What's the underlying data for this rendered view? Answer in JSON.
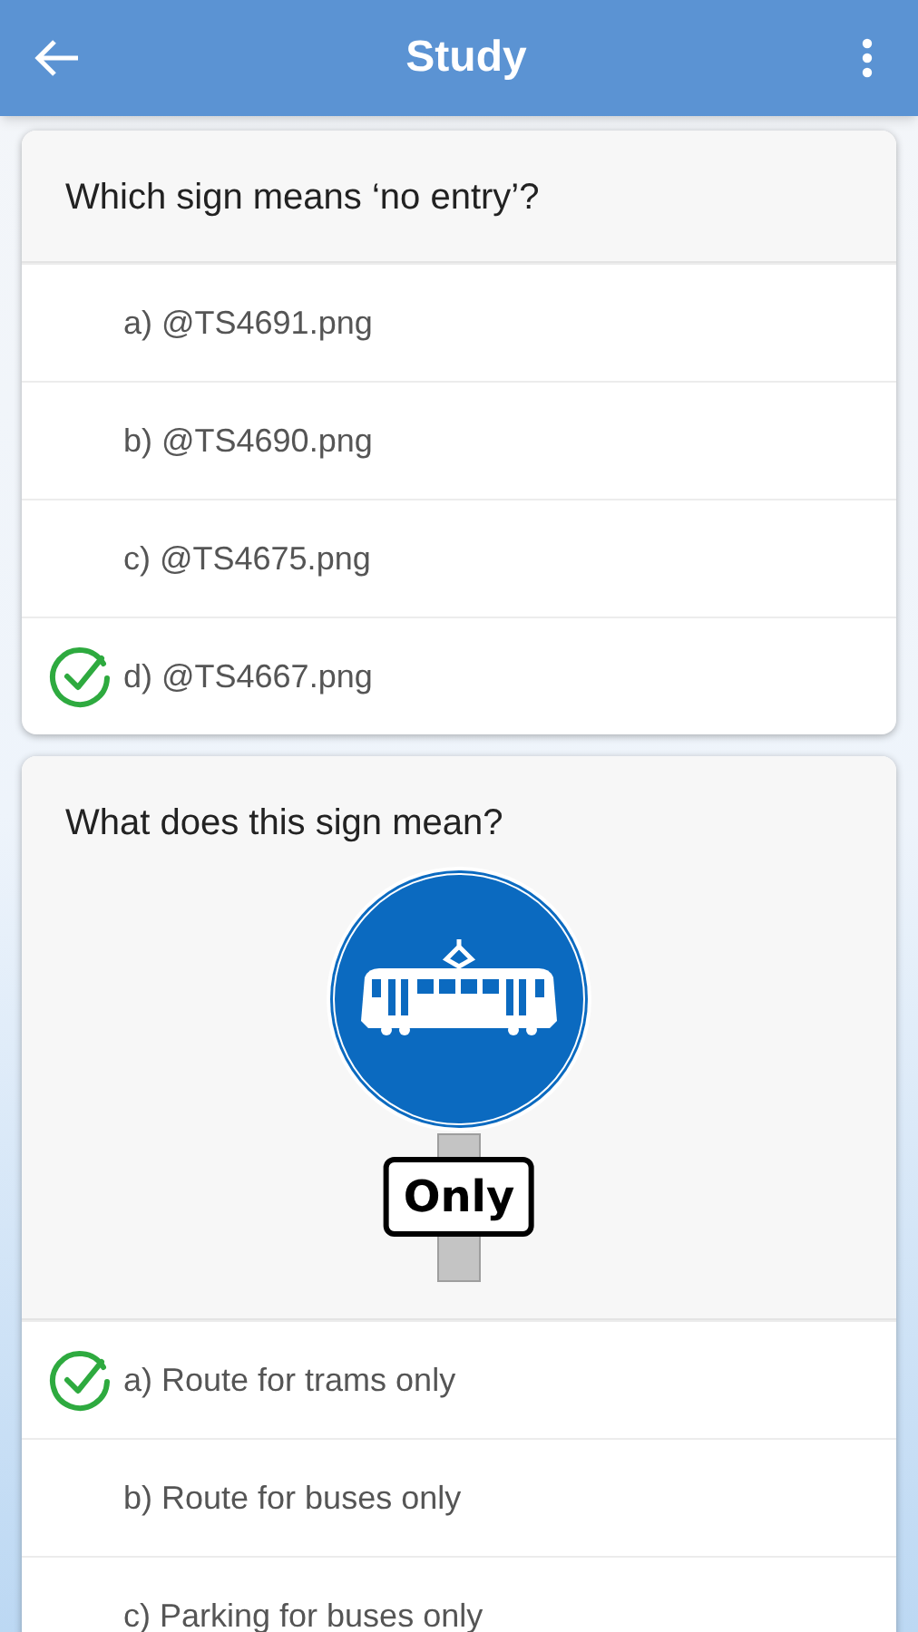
{
  "app_bar": {
    "title": "Study"
  },
  "questions": [
    {
      "text": "Which sign means ‘no entry’?",
      "options": [
        {
          "label": "a) @TS4691.png",
          "correct": false
        },
        {
          "label": "b) @TS4690.png",
          "correct": false
        },
        {
          "label": "c) @TS4675.png",
          "correct": false
        },
        {
          "label": "d) @TS4667.png",
          "correct": true
        }
      ]
    },
    {
      "text": "What does this sign mean?",
      "image": {
        "kind": "tram-sign",
        "plate": "Only"
      },
      "options": [
        {
          "label": "a) Route for trams only",
          "correct": true
        },
        {
          "label": "b) Route for buses only",
          "correct": false
        },
        {
          "label": "c) Parking for buses only",
          "correct": false
        }
      ]
    }
  ]
}
